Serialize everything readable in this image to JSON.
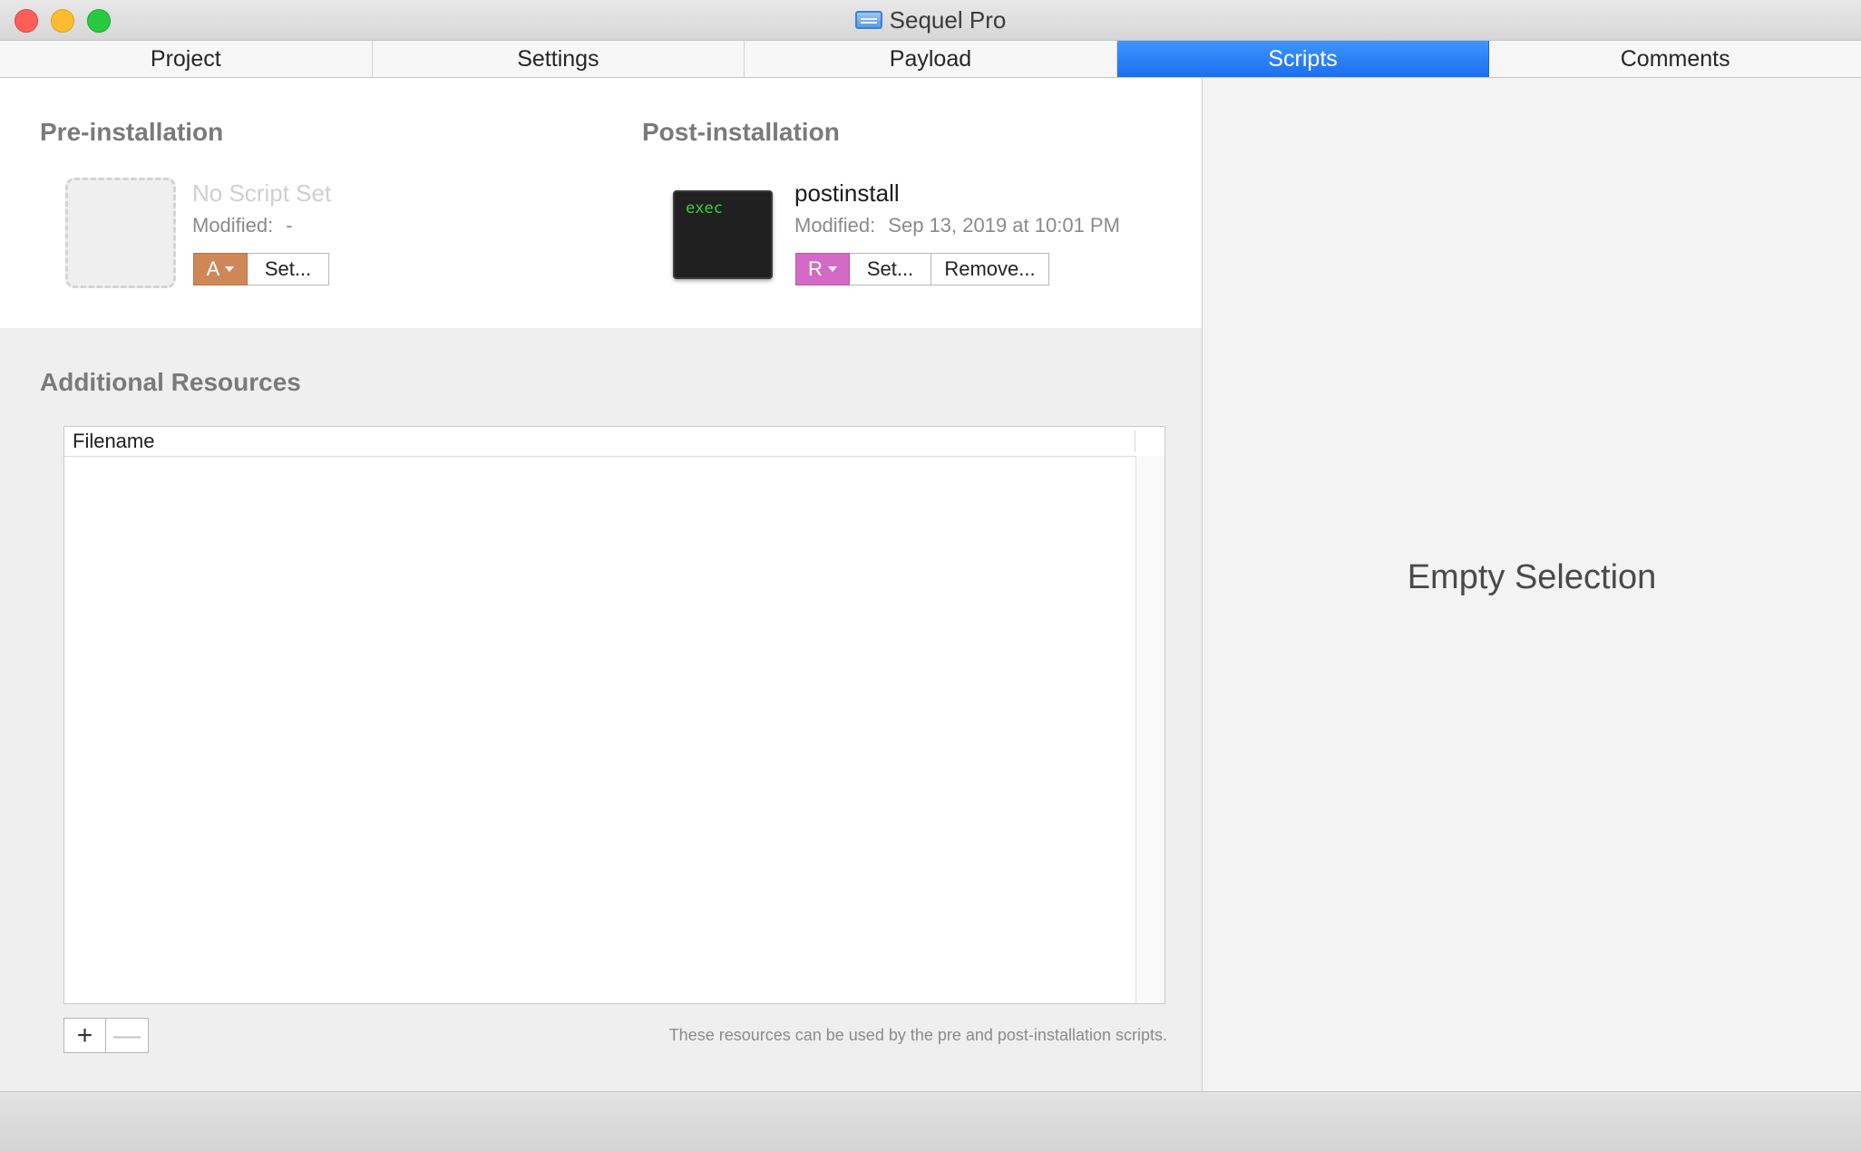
{
  "window": {
    "title": "Sequel Pro",
    "icon": "database-app-icon"
  },
  "tabs": [
    {
      "label": "Project",
      "active": false
    },
    {
      "label": "Settings",
      "active": false
    },
    {
      "label": "Payload",
      "active": false
    },
    {
      "label": "Scripts",
      "active": true
    },
    {
      "label": "Comments",
      "active": false
    }
  ],
  "pre_installation": {
    "heading": "Pre-installation",
    "script_name": "No Script Set",
    "modified_label": "Modified:",
    "modified_value": "-",
    "tag_label": "A",
    "tag_color": "#cf8758",
    "set_label": "Set..."
  },
  "post_installation": {
    "heading": "Post-installation",
    "icon_text": "exec",
    "script_name": "postinstall",
    "modified_label": "Modified:",
    "modified_value": "Sep 13, 2019 at 10:01 PM",
    "tag_label": "R",
    "tag_color": "#d36bc6",
    "set_label": "Set...",
    "remove_label": "Remove..."
  },
  "resources": {
    "heading": "Additional Resources",
    "column_header": "Filename",
    "rows": [],
    "add_label": "+",
    "remove_label": "—",
    "hint": "These resources can be used by the pre and post-installation scripts."
  },
  "inspector": {
    "empty_text": "Empty Selection"
  }
}
